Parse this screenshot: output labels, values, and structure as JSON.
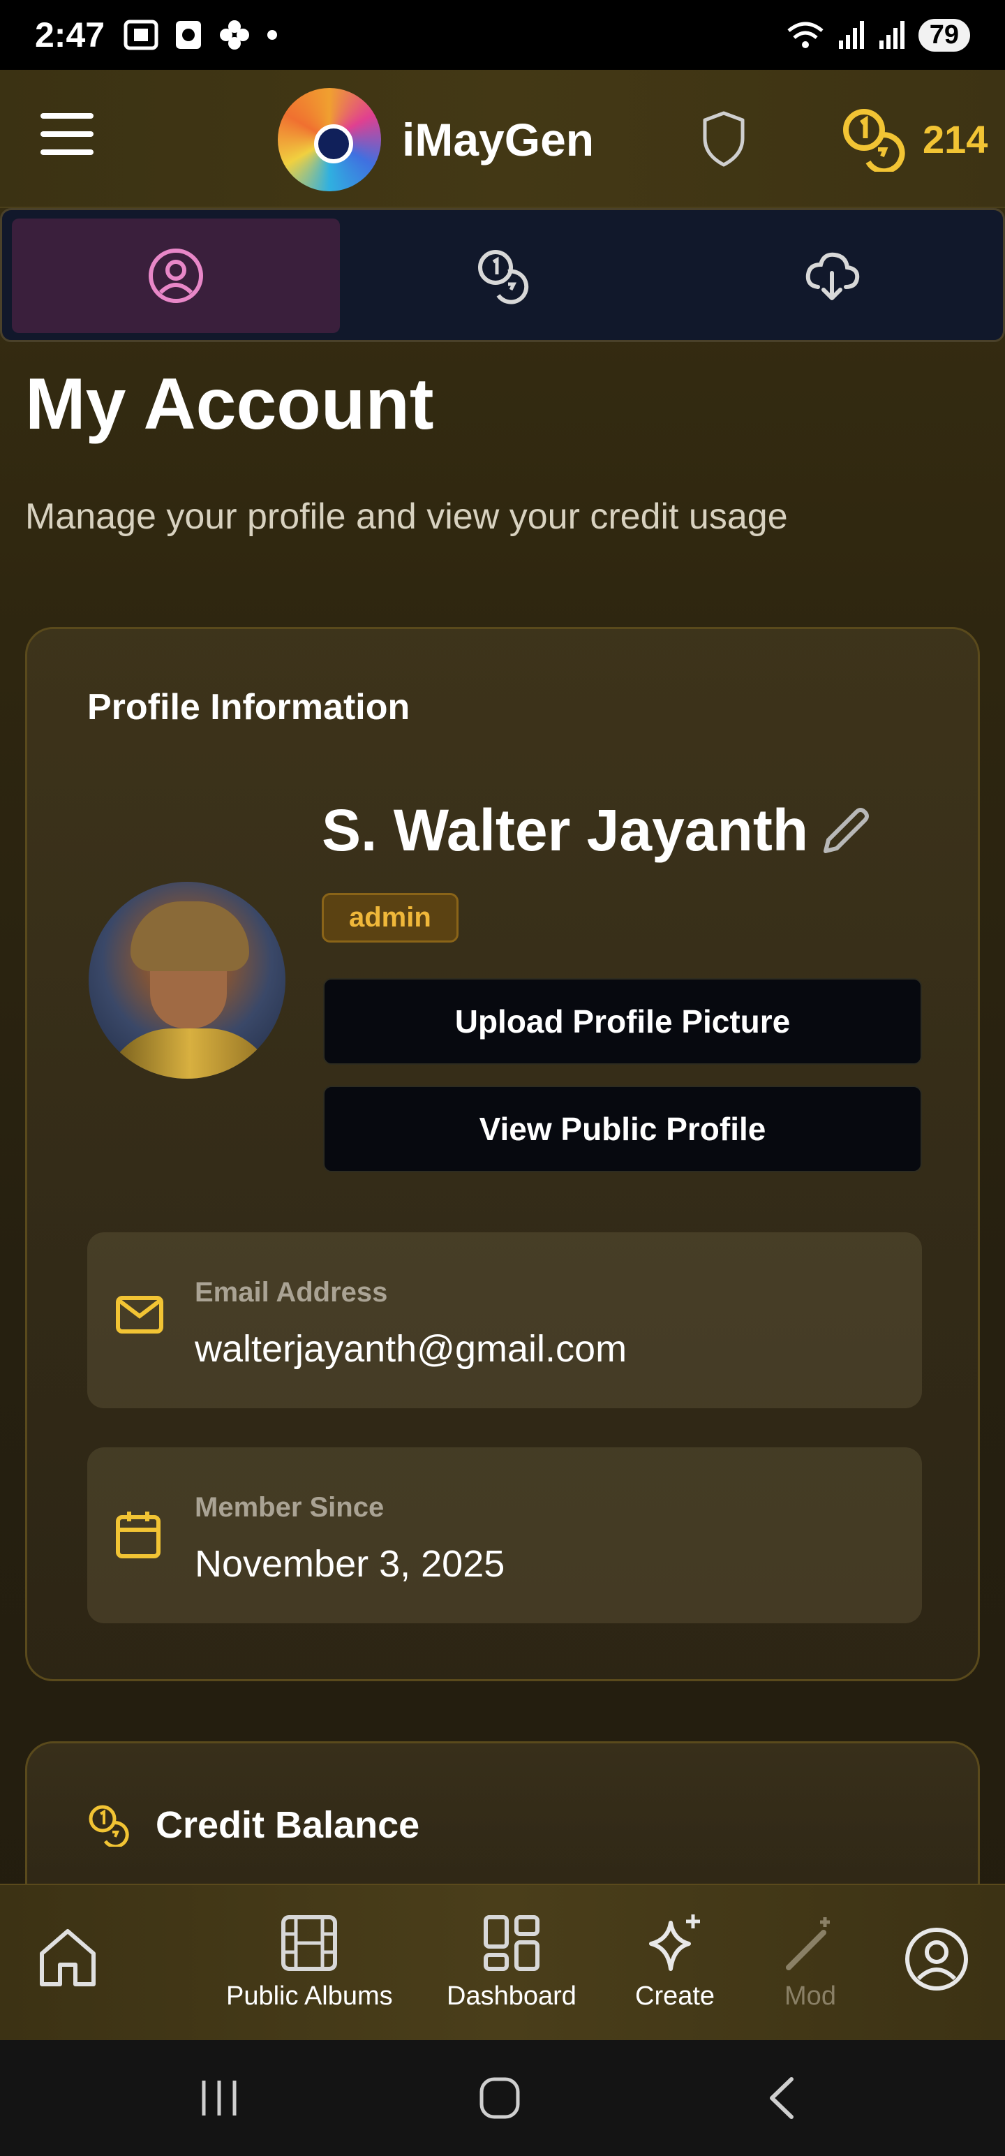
{
  "status_bar": {
    "time": "2:47",
    "battery": "79"
  },
  "header": {
    "app_name": "iMayGen",
    "credits": "214"
  },
  "tabs": [
    {
      "icon": "user-circle-icon",
      "active": true
    },
    {
      "icon": "coins-icon",
      "active": false
    },
    {
      "icon": "cloud-download-icon",
      "active": false
    }
  ],
  "page": {
    "title": "My Account",
    "subtitle": "Manage your profile and view your credit usage"
  },
  "profile": {
    "heading": "Profile Information",
    "name": "S. Walter Jayanth",
    "role": "admin",
    "upload_label": "Upload Profile Picture",
    "view_label": "View Public Profile",
    "email_label": "Email Address",
    "email": "walterjayanth@gmail.com",
    "member_label": "Member Since",
    "member_since": "November 3, 2025"
  },
  "credit": {
    "heading": "Credit Balance"
  },
  "bottom_nav": {
    "home": "",
    "public_albums": "Public Albums",
    "dashboard": "Dashboard",
    "create": "Create",
    "models": "Mod"
  },
  "colors": {
    "accent_gold": "#f2c434",
    "active_tab_pink": "#e887c8",
    "background": "#2e2610"
  }
}
